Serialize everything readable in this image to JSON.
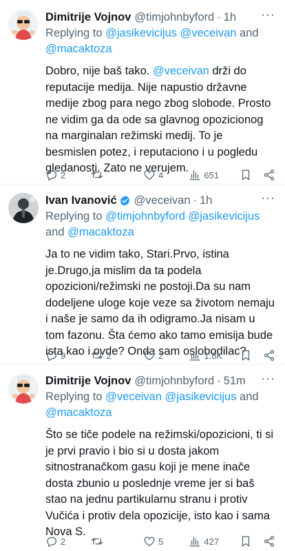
{
  "tweets": [
    {
      "name": "Dimitrije Vojnov",
      "handle": "@timjohnbyford",
      "dot": "·",
      "time": "1h",
      "reply_prefix": "Replying to ",
      "reply_m1": "@jasikevicijus",
      "reply_m2": "@veceivan",
      "reply_and": " and",
      "reply_m3": "@macaktoza",
      "text_a": "Dobro, nije baš tako. ",
      "text_mention": "@veceivan",
      "text_b": " drži do reputacije medija. Nije napustio državne medije zbog para nego zbog slobode. Prosto ne vidim ga da ode sa glavnog opozicionog na marginalan režimski medij. To je besmislen potez, i reputaciono i u pogledu gledanosti. Zato ne verujem.",
      "replies": "2",
      "retweets": "",
      "likes": "4",
      "views": "651"
    },
    {
      "name": "Ivan Ivanović",
      "handle": "@veceivan",
      "dot": "·",
      "time": "1h",
      "reply_prefix": "Replying to ",
      "reply_m1": "@timjohnbyford",
      "reply_m2": "@jasikevicijus",
      "reply_and": " and",
      "reply_m3": "@macaktoza",
      "text": "Ja to ne vidim tako, Stari.Prvo, istina je.Drugo,ja mislim da ta podela opozicioni/režimski ne postoji.Da su nam dodeljene uloge koje veze sa životom nemaju i naše je samo da ih odigramo.Ja nisam u tom fazonu. Šta ćemo ako tamo emisija bude ista kao i ovde? Onda sam oslobodilac?",
      "replies": "9",
      "retweets": "2",
      "likes": "2",
      "views": "1.8K"
    },
    {
      "name": "Dimitrije Vojnov",
      "handle": "@timjohnbyford",
      "dot": "·",
      "time": "51m",
      "reply_prefix": "Replying to ",
      "reply_m1": "@veceivan",
      "reply_m2": "@jasikevicijus",
      "reply_and": " and",
      "reply_m3": "@macaktoza",
      "text": "Što se tiče podele na režimski/opozicioni, ti si je prvi pravio i bio si u dosta jakom sitnostranačkom gasu koji je mene inače dosta zbunio u poslednje vreme jer si baš stao na jednu partikularnu stranu i protiv Vučića i protiv dela opozicije, isto kao i sama Nova S.",
      "replies": "2",
      "retweets": "",
      "likes": "5",
      "views": "427"
    }
  ],
  "more_glyph": "···",
  "colors": {
    "mention": "#1d9bf0",
    "secondary": "#536471",
    "text": "#0f1419",
    "verified": "#1d9bf0"
  },
  "icons": [
    "reply-icon",
    "retweet-icon",
    "like-icon",
    "views-icon",
    "bookmark-icon",
    "share-icon",
    "verified-badge-icon",
    "more-icon"
  ]
}
